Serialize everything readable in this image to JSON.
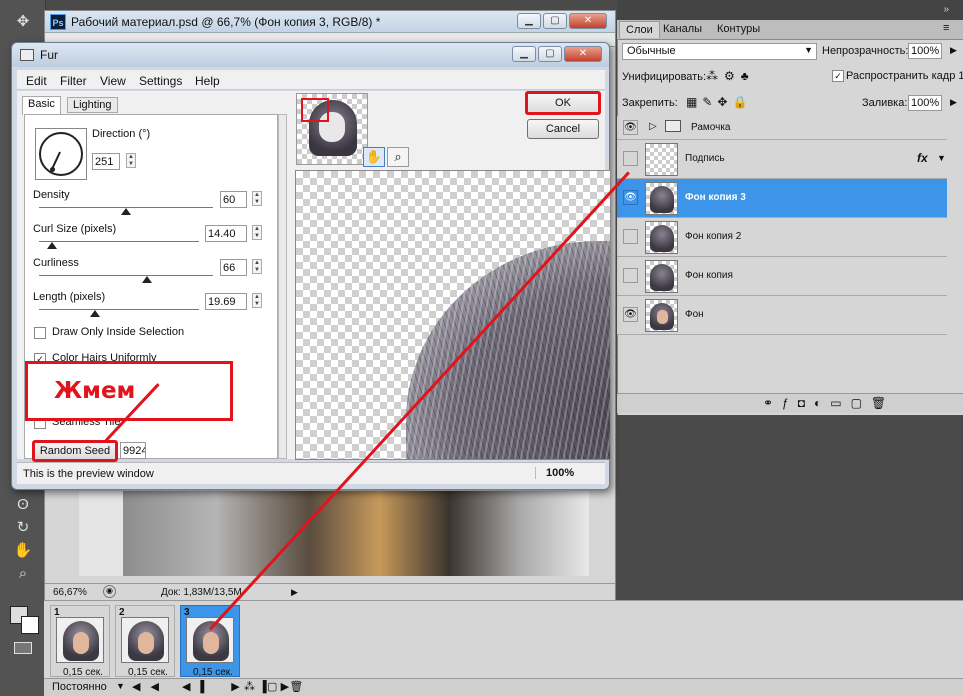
{
  "document": {
    "title": "Рабочий материал.psd @ 66,7% (Фон копия 3, RGB/8) *",
    "app_icon": "Ps",
    "zoom": "66,67%",
    "doc_size": "Док: 1,83M/13,5M"
  },
  "layers_panel": {
    "tabs": [
      "Слои",
      "Каналы",
      "Контуры"
    ],
    "blend_mode": "Обычные",
    "opacity_label": "Непрозрачность:",
    "opacity_value": "100%",
    "unify_label": "Унифицировать:",
    "propagate_label": "Распространить кадр 1",
    "lock_label": "Закрепить:",
    "fill_label": "Заливка:",
    "fill_value": "100%",
    "layers": [
      {
        "name": "Рамочка",
        "type": "group",
        "visible": true
      },
      {
        "name": "Подпись",
        "type": "layer",
        "visible": false,
        "fx": "fx"
      },
      {
        "name": "Фон копия 3",
        "type": "layer",
        "visible": true,
        "selected": true
      },
      {
        "name": "Фон копия 2",
        "type": "layer",
        "visible": false
      },
      {
        "name": "Фон копия",
        "type": "layer",
        "visible": false
      },
      {
        "name": "Фон",
        "type": "layer",
        "visible": true
      }
    ]
  },
  "timeline": {
    "frames": [
      {
        "num": "1",
        "duration": "0,15 сек."
      },
      {
        "num": "2",
        "duration": "0,15 сек."
      },
      {
        "num": "3",
        "duration": "0,15 сек.",
        "selected": true
      }
    ],
    "loop": "Постоянно"
  },
  "fur_dialog": {
    "title": "Fur",
    "menu": [
      "Edit",
      "Filter",
      "View",
      "Settings",
      "Help"
    ],
    "tabs": [
      "Basic",
      "Lighting"
    ],
    "direction_label": "Direction (°)",
    "direction_value": "251",
    "density_label": "Density",
    "density_value": "60",
    "density_level": 0.5,
    "curl_label": "Curl Size (pixels)",
    "curl_value": "14.40",
    "curl_level": 0.08,
    "curliness_label": "Curliness",
    "curliness_value": "66",
    "curliness_level": 0.62,
    "length_label": "Length (pixels)",
    "length_value": "19.69",
    "length_level": 0.35,
    "draw_only_label": "Draw Only Inside Selection",
    "color_hairs_label": "Color Hairs Uniformly",
    "seamless_label": "Seamless Tile",
    "random_seed_label": "Random Seed",
    "random_seed_value": "9924",
    "ok_label": "OK",
    "cancel_label": "Cancel",
    "status_text": "This is the preview window",
    "preview_zoom": "100%"
  },
  "annotation": {
    "text": "Жмем",
    "color": "#e0141c"
  },
  "colors": {
    "selection_blue": "#3c95e8",
    "annotation_red": "#e0141c"
  }
}
